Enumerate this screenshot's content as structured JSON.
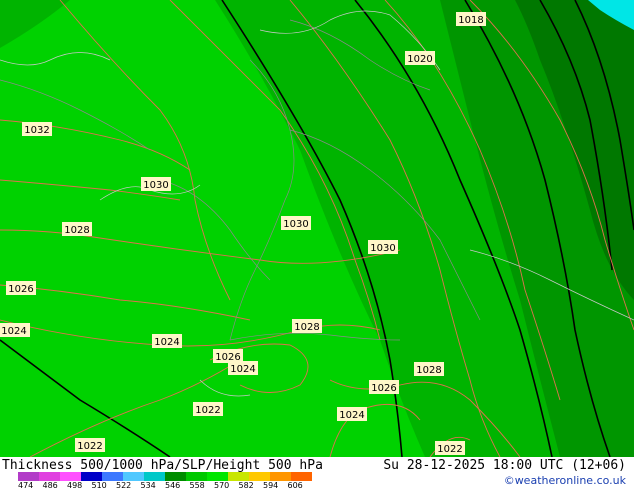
{
  "footer": {
    "title": "Thickness 500/1000 hPa/SLP/Height 500 hPa",
    "datetime": "Su 28-12-2025 18:00 UTC (12+06)",
    "credit": "©weatheronline.co.uk"
  },
  "colorscale": {
    "ticks": [
      "474",
      "486",
      "498",
      "510",
      "522",
      "534",
      "546",
      "558",
      "570",
      "582",
      "594",
      "606"
    ],
    "colors": [
      "#b23cc8",
      "#e040e0",
      "#ff50ff",
      "#0000c8",
      "#3c78ff",
      "#50c8ff",
      "#00c8c8",
      "#008c00",
      "#00c800",
      "#00e600",
      "#c8e600",
      "#ffc800",
      "#ff9600",
      "#ff6400"
    ]
  },
  "map": {
    "background_colors": {
      "light_green": "#00d200",
      "mid_green": "#00b400",
      "dark_green": "#009600",
      "darkest_green": "#007800",
      "cyan": "#00e6e6"
    },
    "isobar_labels": [
      {
        "text": "1018"
      },
      {
        "text": "1020"
      },
      {
        "text": "1032"
      },
      {
        "text": "1030"
      },
      {
        "text": "1028"
      },
      {
        "text": "1030"
      },
      {
        "text": "1030"
      },
      {
        "text": "1026"
      },
      {
        "text": "1024"
      },
      {
        "text": "1024"
      },
      {
        "text": "1028"
      },
      {
        "text": "1026"
      },
      {
        "text": "1024"
      },
      {
        "text": "1028"
      },
      {
        "text": "1026"
      },
      {
        "text": "1022"
      },
      {
        "text": "1024"
      },
      {
        "text": "1022"
      },
      {
        "text": "1022"
      }
    ]
  }
}
